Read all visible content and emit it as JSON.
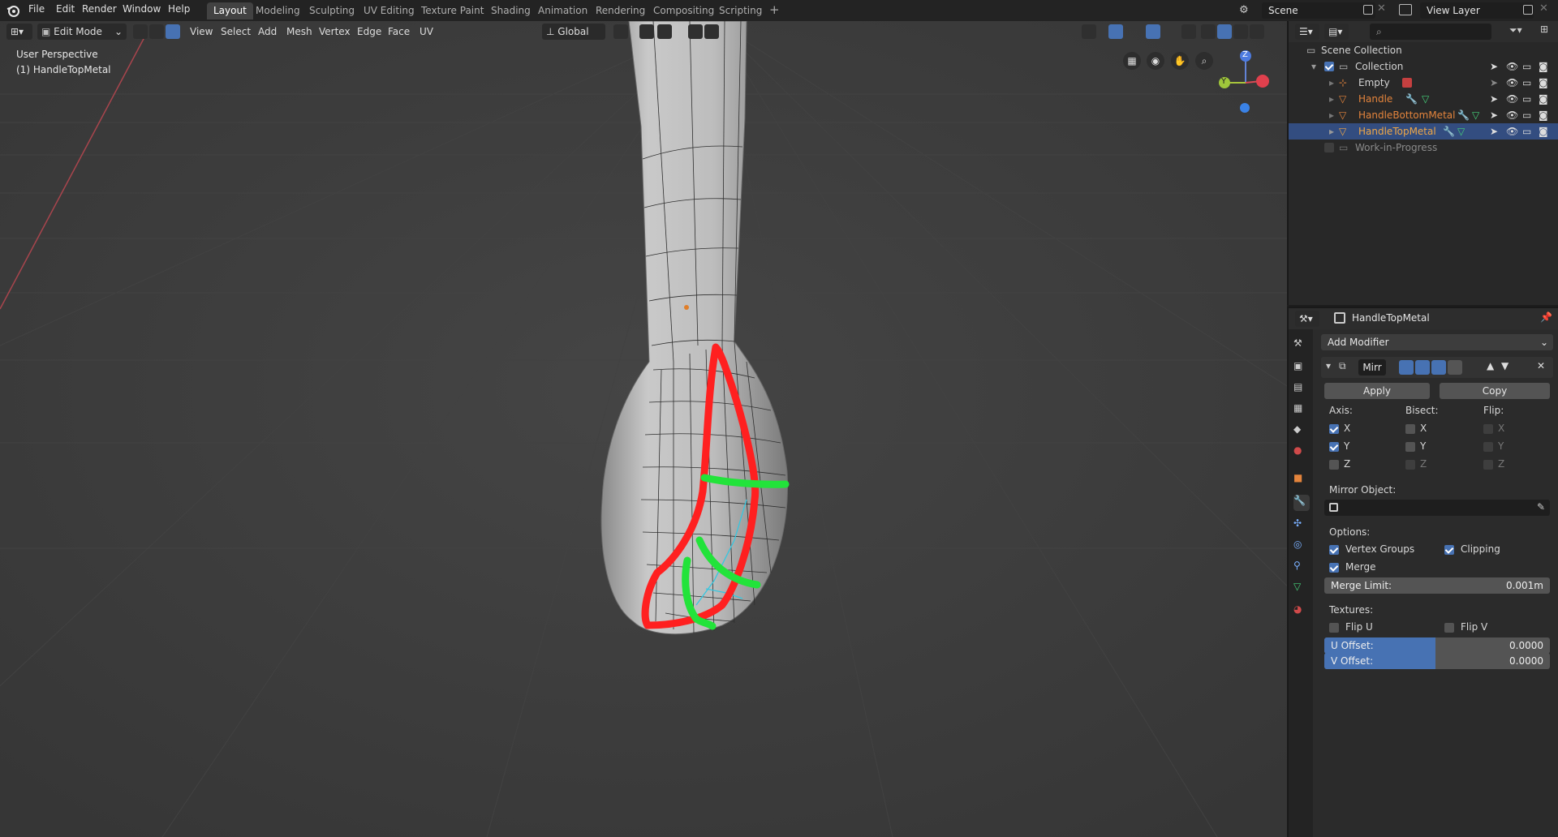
{
  "topbar": {
    "menus": [
      "File",
      "Edit",
      "Render",
      "Window",
      "Help"
    ],
    "workspaces": [
      "Layout",
      "Modeling",
      "Sculpting",
      "UV Editing",
      "Texture Paint",
      "Shading",
      "Animation",
      "Rendering",
      "Compositing",
      "Scripting"
    ],
    "active_workspace": "Layout",
    "add_tab": "+",
    "scene": "Scene",
    "view_layer": "View Layer"
  },
  "viewport": {
    "mode": "Edit Mode",
    "menus": [
      "View",
      "Select",
      "Add",
      "Mesh",
      "Vertex",
      "Edge",
      "Face",
      "UV"
    ],
    "orientation": "Global",
    "overlay_title": "User Perspective",
    "overlay_object": "(1) HandleTopMetal",
    "gizmo": {
      "x": "X",
      "y": "Y",
      "z": "Z"
    }
  },
  "outliner": {
    "root": "Scene Collection",
    "collection": "Collection",
    "items": [
      {
        "name": "Empty",
        "color": "#d0d0d0"
      },
      {
        "name": "Handle",
        "color": "#e4843c"
      },
      {
        "name": "HandleBottomMetal",
        "color": "#e4843c"
      },
      {
        "name": "HandleTopMetal",
        "color": "#f0a847"
      }
    ],
    "excluded": "Work-in-Progress"
  },
  "properties": {
    "object": "HandleTopMetal",
    "add_modifier": "Add Modifier",
    "modifier_name": "Mirr",
    "apply": "Apply",
    "copy": "Copy",
    "axis_label": "Axis:",
    "bisect_label": "Bisect:",
    "flip_label": "Flip:",
    "axes": [
      "X",
      "Y",
      "Z"
    ],
    "axis_checked": [
      true,
      true,
      false
    ],
    "mirror_object_label": "Mirror Object:",
    "options_label": "Options:",
    "vertex_groups": "Vertex Groups",
    "clipping": "Clipping",
    "merge": "Merge",
    "merge_limit_label": "Merge Limit:",
    "merge_limit_value": "0.001m",
    "textures_label": "Textures:",
    "flip_u": "Flip U",
    "flip_v": "Flip V",
    "u_offset_label": "U Offset:",
    "u_offset_value": "0.0000",
    "v_offset_label": "V Offset:",
    "v_offset_value": "0.0000"
  },
  "colors": {
    "accent": "#4772b3",
    "annotation_red": "#ff2020",
    "annotation_green": "#22e33a",
    "selected_object": "#f0a847"
  }
}
